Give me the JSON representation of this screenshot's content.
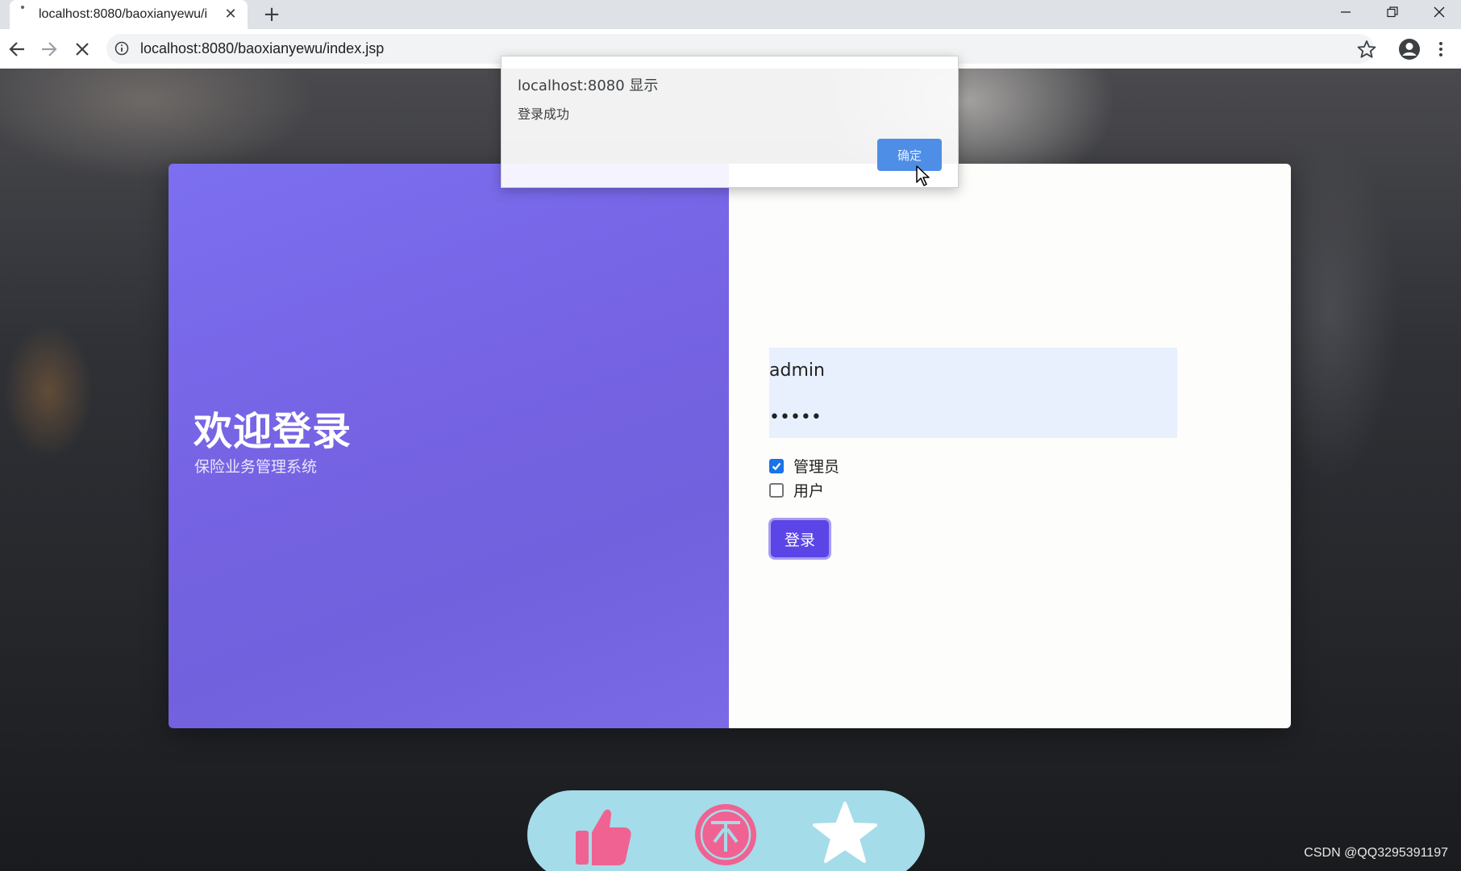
{
  "browser": {
    "tab_title": "localhost:8080/baoxianyewu/i",
    "url": "localhost:8080/baoxianyewu/index.jsp"
  },
  "login": {
    "title": "欢迎登录",
    "subtitle": "保险业务管理系统",
    "username_value": "admin",
    "password_value": "•••••",
    "roles": [
      {
        "label": "管理员",
        "checked": true
      },
      {
        "label": "用户",
        "checked": false
      }
    ],
    "login_button": "登录"
  },
  "alert": {
    "title": "localhost:8080 显示",
    "message": "登录成功",
    "ok_button": "确定"
  },
  "overlay": {
    "icons": [
      "thumbs-up-icon",
      "coin-icon",
      "star-icon"
    ],
    "bar_color": "#a4dce9",
    "icon_color": "#f06292"
  },
  "watermark": "CSDN @QQ3295391197"
}
